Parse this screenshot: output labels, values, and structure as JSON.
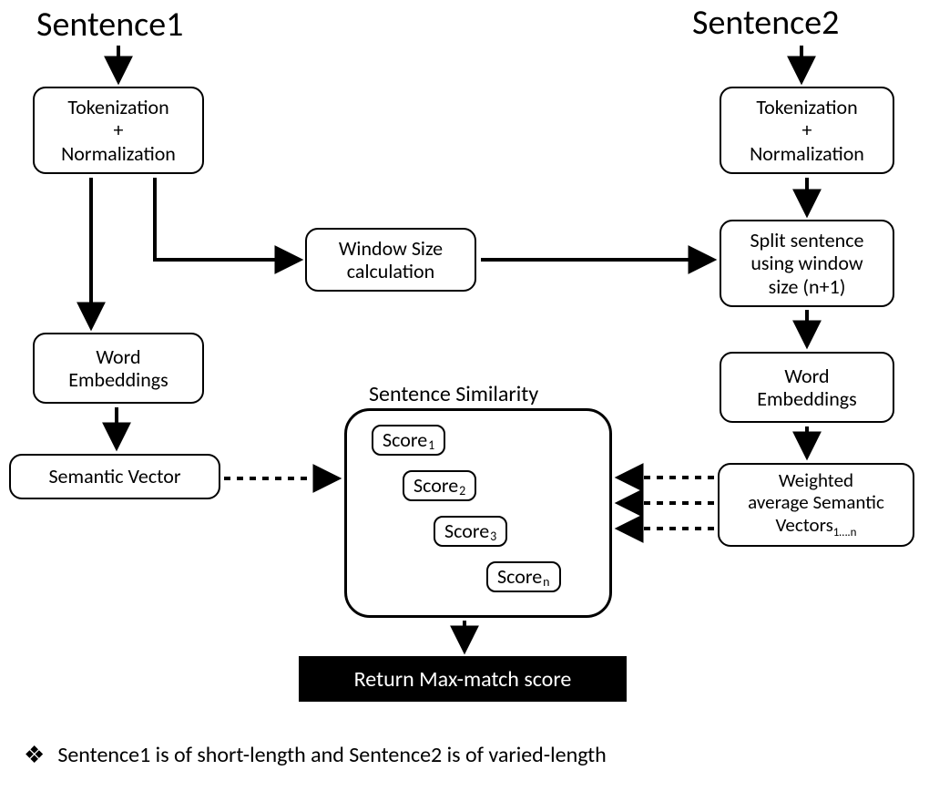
{
  "titles": {
    "sentence1": "Sentence1",
    "sentence2": "Sentence2"
  },
  "left": {
    "tokenization": "Tokenization\n+\nNormalization",
    "word_embeddings": "Word\nEmbeddings",
    "semantic_vector": "Semantic Vector"
  },
  "right": {
    "tokenization": "Tokenization\n+\nNormalization",
    "split": "Split sentence\nusing window\nsize (n+1)",
    "word_embeddings": "Word\nEmbeddings",
    "weighted": "Weighted\naverage Semantic\nVectors"
  },
  "center": {
    "window_size": "Window Size\ncalculation"
  },
  "similarity": {
    "label": "Sentence Similarity",
    "score1": "Score",
    "score1_sub": "1",
    "score2": "Score",
    "score2_sub": "2",
    "score3": "Score",
    "score3_sub": "3",
    "score4": "Score",
    "score4_sub": "n"
  },
  "result": "Return Max-match score",
  "footnote": "Sentence1 is of short-length and Sentence2 is of varied-length",
  "vectors_sub": "1….n"
}
